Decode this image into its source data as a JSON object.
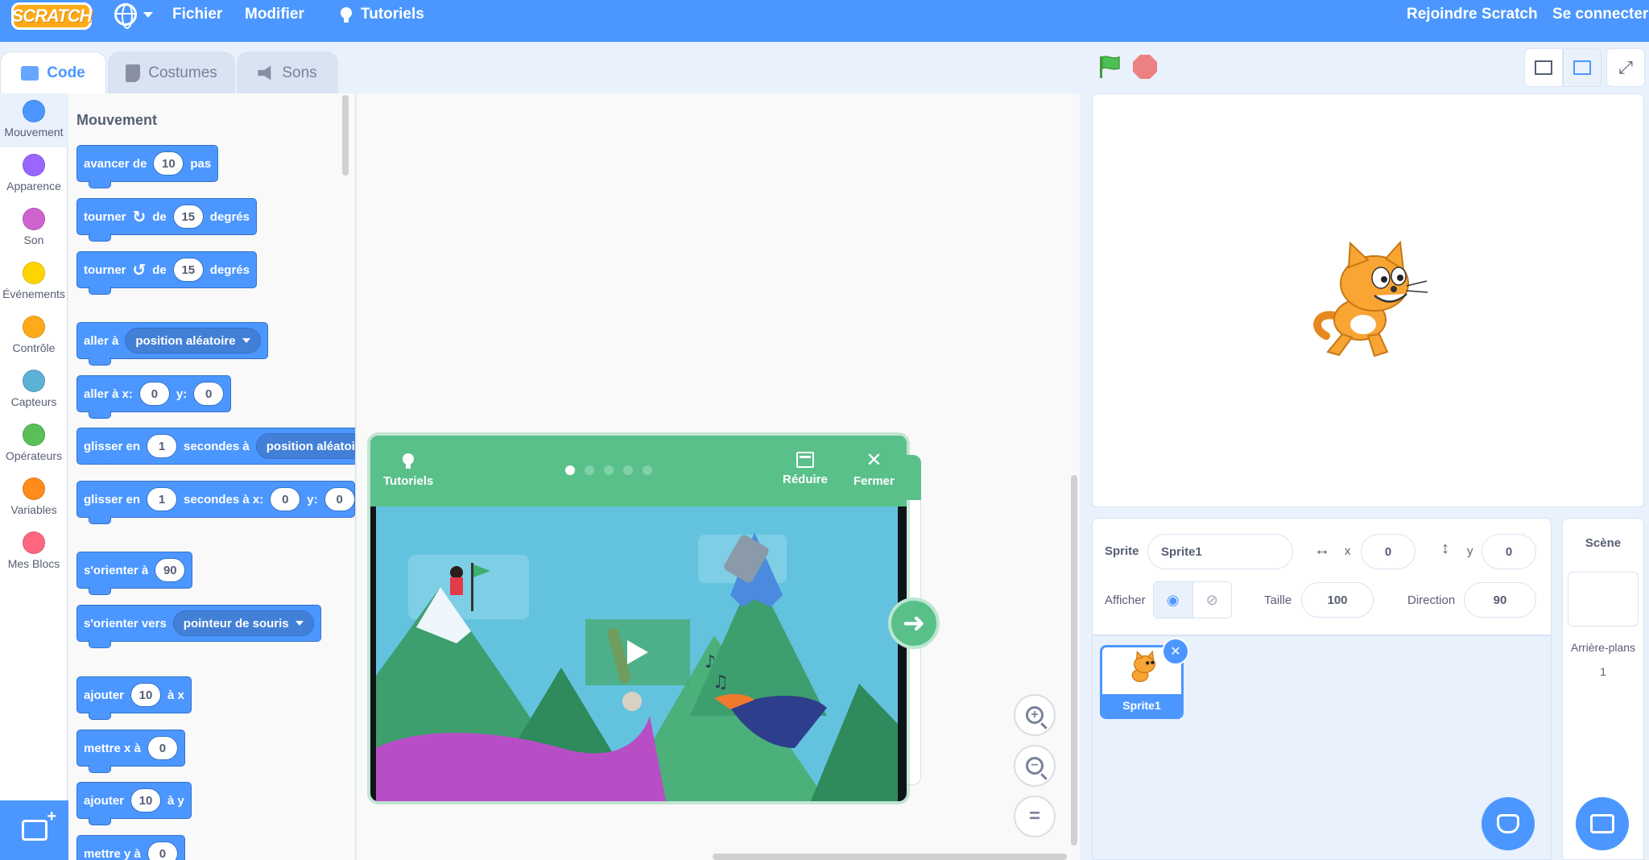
{
  "menu": {
    "logo": "SCRATCH",
    "file": "Fichier",
    "edit": "Modifier",
    "tutorials": "Tutoriels",
    "join": "Rejoindre Scratch",
    "sign_in": "Se connecter"
  },
  "tabs": [
    {
      "label": "Code"
    },
    {
      "label": "Costumes"
    },
    {
      "label": "Sons"
    }
  ],
  "categories": [
    {
      "label": "Mouvement",
      "color": "#4c97ff"
    },
    {
      "label": "Apparence",
      "color": "#9966ff"
    },
    {
      "label": "Son",
      "color": "#cf63cf"
    },
    {
      "label": "Événements",
      "color": "#ffd500"
    },
    {
      "label": "Contrôle",
      "color": "#ffab19"
    },
    {
      "label": "Capteurs",
      "color": "#5cb1d6"
    },
    {
      "label": "Opérateurs",
      "color": "#59c059"
    },
    {
      "label": "Variables",
      "color": "#ff8c1a"
    },
    {
      "label": "Mes Blocs",
      "color": "#ff6680"
    }
  ],
  "palette": {
    "section_title": "Mouvement",
    "move": {
      "a": "avancer de",
      "v": "10",
      "b": "pas"
    },
    "turn_right": {
      "a": "tourner",
      "b": "de",
      "v": "15",
      "c": "degrés"
    },
    "turn_left": {
      "a": "tourner",
      "b": "de",
      "v": "15",
      "c": "degrés"
    },
    "goto": {
      "a": "aller à",
      "dd": "position aléatoire"
    },
    "goto_xy": {
      "a": "aller à x:",
      "x": "0",
      "b": "y:",
      "y": "0"
    },
    "glide_to": {
      "a": "glisser en",
      "v": "1",
      "b": "secondes à",
      "dd": "position aléatoire"
    },
    "glide_xy": {
      "a": "glisser en",
      "v": "1",
      "b": "secondes à x:",
      "x": "0",
      "c": "y:",
      "y": "0"
    },
    "point_dir": {
      "a": "s'orienter à",
      "v": "90"
    },
    "point_towards": {
      "a": "s'orienter vers",
      "dd": "pointeur de souris"
    },
    "change_x": {
      "a": "ajouter",
      "v": "10",
      "b": "à x"
    },
    "set_x": {
      "a": "mettre x à",
      "v": "0"
    },
    "change_y": {
      "a": "ajouter",
      "v": "10",
      "b": "à y"
    },
    "set_y": {
      "a": "mettre y à",
      "v": "0"
    }
  },
  "tutorial": {
    "tutorials": "Tutoriels",
    "shrink": "Réduire",
    "close": "Fermer",
    "step": 1,
    "steps": 5
  },
  "sprite_info": {
    "sprite_label": "Sprite",
    "sprite_name": "Sprite1",
    "x_label": "x",
    "x": "0",
    "y_label": "y",
    "y": "0",
    "show_label": "Afficher",
    "size_label": "Taille",
    "size": "100",
    "direction_label": "Direction",
    "direction": "90"
  },
  "sprites": [
    {
      "name": "Sprite1"
    }
  ],
  "stage_panel": {
    "title": "Scène",
    "backdrops_label": "Arrière-plans",
    "backdrops_count": "1"
  }
}
